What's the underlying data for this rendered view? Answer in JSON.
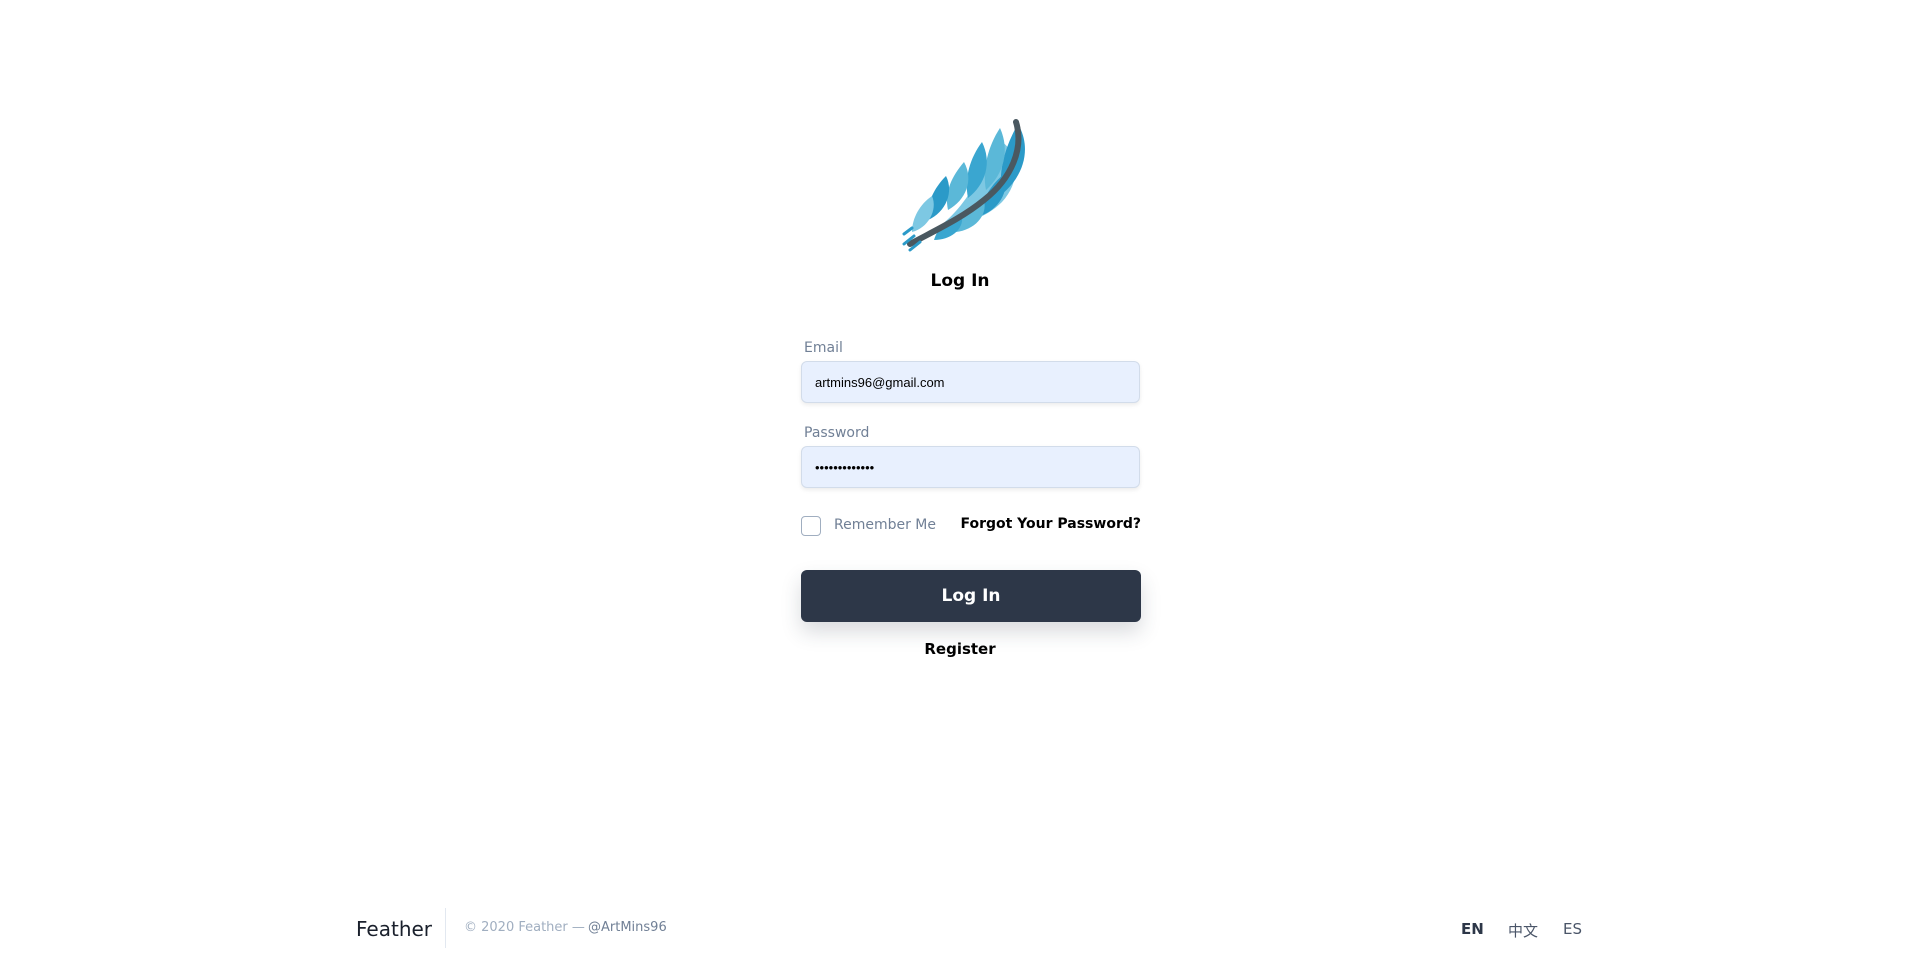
{
  "login": {
    "logo_icon": "feather-icon",
    "title": "Log In",
    "email_label": "Email",
    "email_value": "artmins96@gmail.com",
    "password_label": "Password",
    "password_value": "•••••••••••••",
    "remember_label": "Remember Me",
    "forgot_label": "Forgot Your Password?",
    "submit_label": "Log In",
    "register_label": "Register"
  },
  "footer": {
    "brand": "Feather",
    "copyright": "© 2020 Feather —",
    "handle": "@ArtMins96",
    "languages": [
      "EN",
      "中文",
      "ES"
    ]
  },
  "colors": {
    "button_bg": "#2d3748",
    "input_bg": "#e8f0fe",
    "feather_light": "#5bb8d8",
    "feather_dark": "#2b9ac8",
    "feather_stem": "#4a5860"
  }
}
